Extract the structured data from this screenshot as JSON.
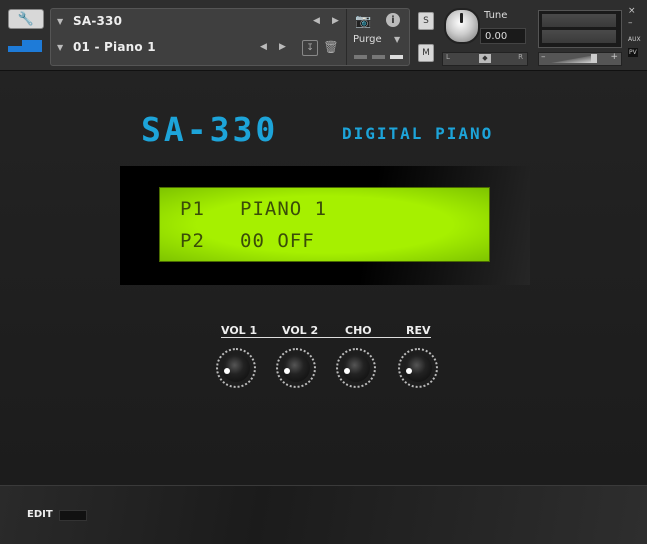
{
  "header": {
    "instrument_name": "SA-330",
    "preset_name": "01 - Piano 1",
    "purge_label": "Purge",
    "solo_label": "S",
    "mute_label": "M",
    "tune_label": "Tune",
    "tune_value": "0.00",
    "pan_left": "L",
    "pan_right": "R",
    "aux_label": "AUX",
    "pv_label": "PV",
    "close_label": "×",
    "minimize_label": "–"
  },
  "logo": {
    "title": "SA-330",
    "subtitle": "DIGITAL PIANO"
  },
  "display": {
    "line1_label": "P1",
    "line1_value": "PIANO 1",
    "line2_label": "P2",
    "line2_value": "00 OFF"
  },
  "knobs": [
    {
      "label": "VOL 1"
    },
    {
      "label": "VOL 2"
    },
    {
      "label": "CHO"
    },
    {
      "label": "REV"
    }
  ],
  "footer": {
    "edit_label": "EDIT"
  },
  "colors": {
    "accent": "#1da4d9",
    "lcd_bg": "#a6f000",
    "lcd_text": "#3a4d08",
    "header_bg": "#2e2e2e",
    "body_bg": "#1c1c1c"
  },
  "icons": [
    "wrench-icon",
    "camera-icon",
    "info-icon",
    "save-icon",
    "trash-icon",
    "dropdown-triangle-icon",
    "arrow-left-icon",
    "arrow-right-icon"
  ]
}
